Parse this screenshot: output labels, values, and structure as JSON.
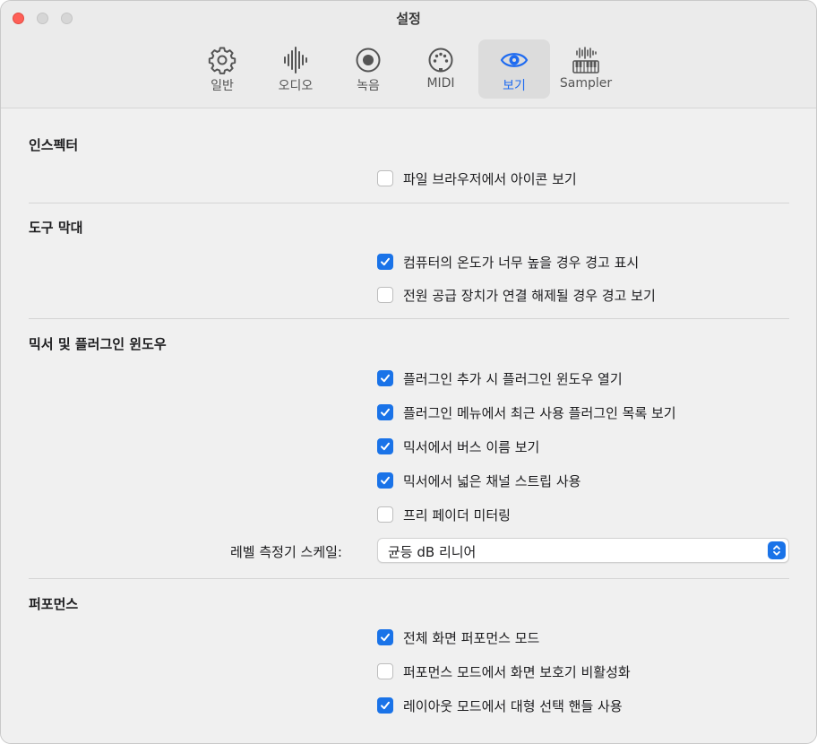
{
  "window": {
    "title": "설정"
  },
  "tabs": [
    {
      "label": "일반",
      "icon": "gear-icon"
    },
    {
      "label": "오디오",
      "icon": "waveform-icon"
    },
    {
      "label": "녹음",
      "icon": "record-icon"
    },
    {
      "label": "MIDI",
      "icon": "midi-port-icon"
    },
    {
      "label": "보기",
      "icon": "eye-icon",
      "active": true
    },
    {
      "label": "Sampler",
      "icon": "sampler-keyboard-icon"
    }
  ],
  "sections": {
    "inspector": {
      "title": "인스펙터",
      "options": [
        {
          "label": "파일 브라우저에서 아이콘 보기",
          "checked": false
        }
      ]
    },
    "toolbar": {
      "title": "도구 막대",
      "options": [
        {
          "label": "컴퓨터의 온도가 너무 높을 경우 경고 표시",
          "checked": true
        },
        {
          "label": "전원 공급 장치가 연결 해제될 경우 경고 보기",
          "checked": false
        }
      ]
    },
    "mixer": {
      "title": "믹서 및 플러그인 윈도우",
      "options": [
        {
          "label": "플러그인 추가 시 플러그인 윈도우 열기",
          "checked": true
        },
        {
          "label": "플러그인 메뉴에서 최근 사용 플러그인 목록 보기",
          "checked": true
        },
        {
          "label": "믹서에서 버스 이름 보기",
          "checked": true
        },
        {
          "label": "믹서에서 넓은 채널 스트립 사용",
          "checked": true
        },
        {
          "label": "프리 페이더 미터링",
          "checked": false
        }
      ],
      "level_meter_label": "레벨 측정기 스케일:",
      "level_meter_value": "균등 dB 리니어"
    },
    "performance": {
      "title": "퍼포먼스",
      "options": [
        {
          "label": "전체 화면 퍼포먼스 모드",
          "checked": true
        },
        {
          "label": "퍼포먼스 모드에서 화면 보호기 비활성화",
          "checked": false
        },
        {
          "label": "레이아웃 모드에서 대형 선택 핸들 사용",
          "checked": true
        }
      ]
    }
  },
  "colors": {
    "accent": "#1a73e8",
    "active_tab_text": "#1f6bf0",
    "close_button": "#fe5f57"
  }
}
